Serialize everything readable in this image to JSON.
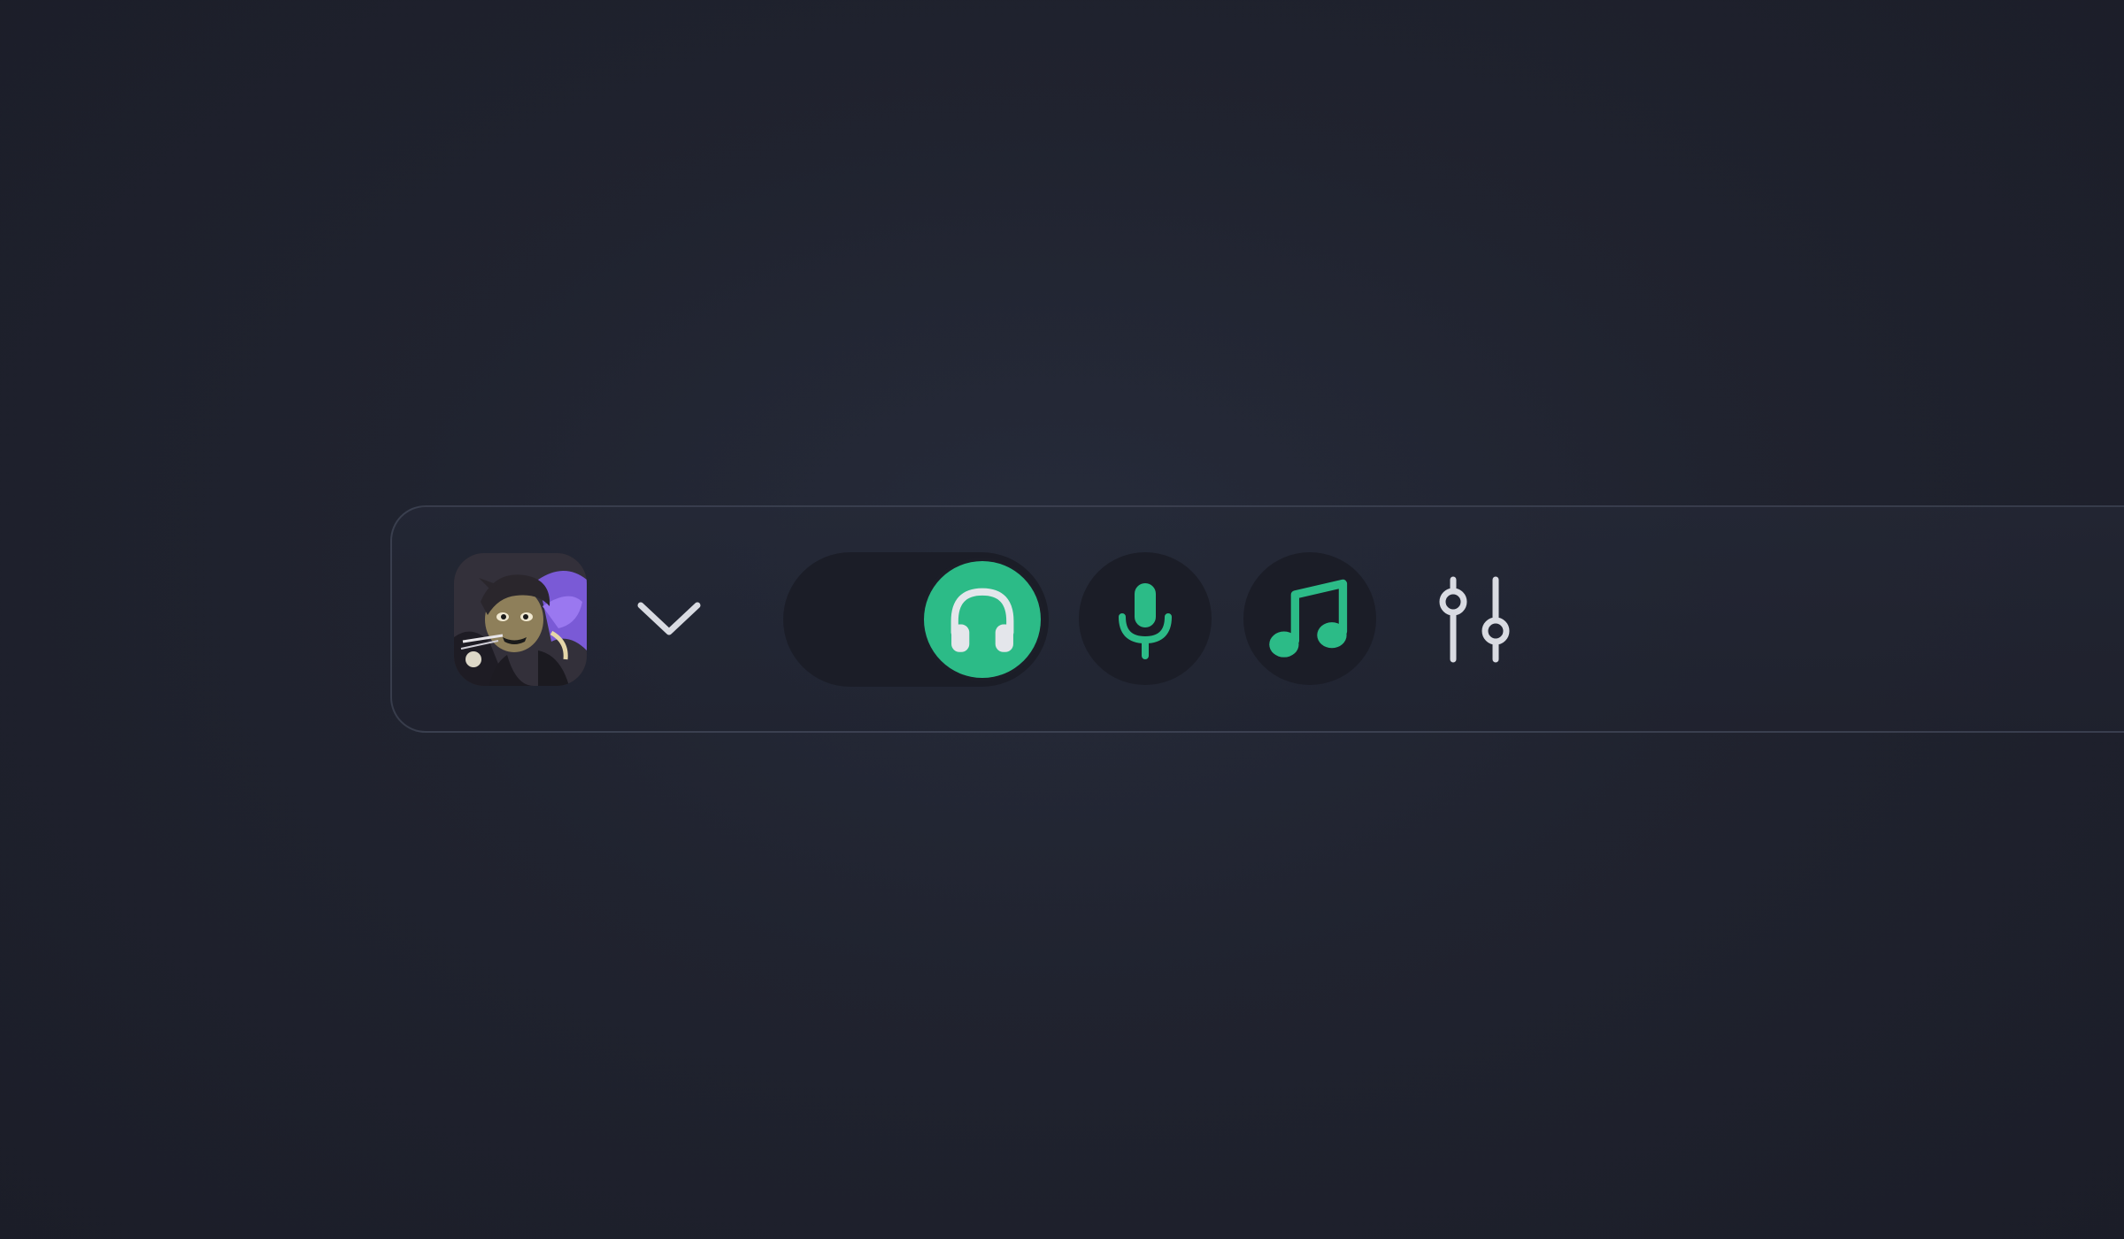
{
  "toolbar": {
    "avatar_label": "",
    "colors": {
      "accent": "#2cbb87",
      "icon_light": "#d9dbe2",
      "button_bg": "#1b1d27",
      "bar_border": "#3a3f50"
    },
    "icons": {
      "dropdown": "chevron-down-icon",
      "headphones": "headphones-icon",
      "microphone": "microphone-icon",
      "music": "music-note-icon",
      "mixer": "sliders-icon"
    },
    "headphones_toggle_on": true
  }
}
